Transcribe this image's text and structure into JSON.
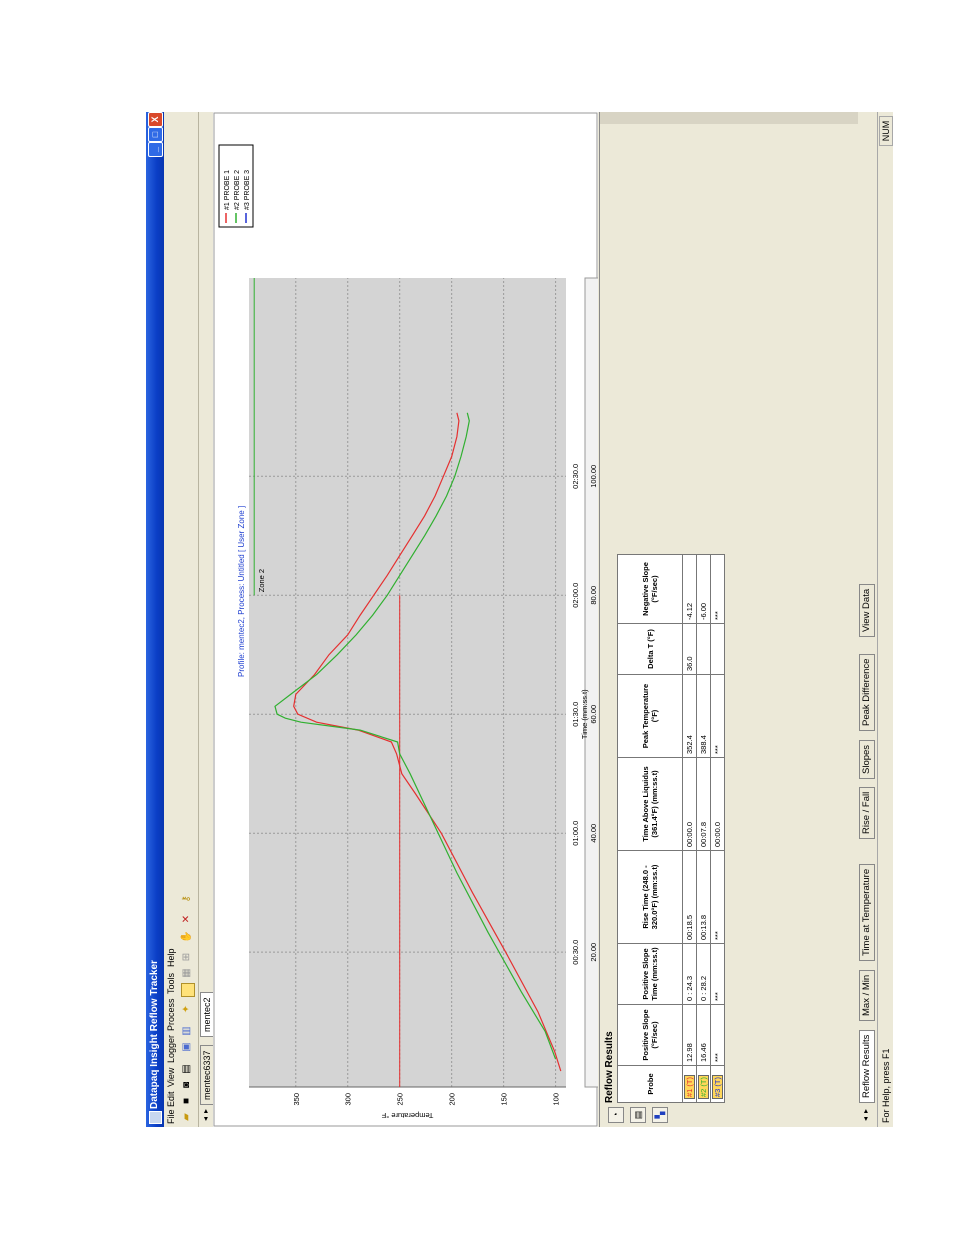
{
  "window": {
    "title": "Datapaq Insight Reflow Tracker",
    "controls": [
      "_",
      "□",
      "X"
    ]
  },
  "menu": [
    "File",
    "Edit",
    "View",
    "Logger",
    "Process",
    "Tools",
    "Help"
  ],
  "file_tabs": [
    "mentec6337",
    "mentec2"
  ],
  "chart_title": "Profile: mentec2, Process: Untitled [ User Zone ]",
  "chart_data": {
    "type": "line",
    "ylabel": "Temperature °F",
    "xlabel": "Time (mm:ss.t)",
    "x2label": "Distance (in)",
    "ylim": [
      90,
      395
    ],
    "y_ticks": [
      "100",
      "150",
      "200",
      "250",
      "300",
      "350"
    ],
    "x_ticks": [
      "00:30.0",
      "01:00.0",
      "01:30.0",
      "02:00.0",
      "02:30.0"
    ],
    "x2_ticks": [
      "20.00",
      "40.00",
      "60.00",
      "80.00",
      "100.00"
    ],
    "zone_label": "Zone 2",
    "zone_value": 390,
    "limit_line": 250,
    "colors": {
      "probe1": "#e53030",
      "probe2": "#30b030",
      "probe3": "#2030d0"
    },
    "series": [
      {
        "name": "#1 PROBE 1",
        "points": [
          [
            0,
            95
          ],
          [
            5,
            101
          ],
          [
            15,
            117
          ],
          [
            30,
            148
          ],
          [
            45,
            180
          ],
          [
            60,
            210
          ],
          [
            70,
            235
          ],
          [
            75,
            248
          ],
          [
            80,
            253
          ],
          [
            83,
            258
          ],
          [
            86,
            290
          ],
          [
            88,
            330
          ],
          [
            90,
            348
          ],
          [
            92,
            352
          ],
          [
            95,
            350
          ],
          [
            100,
            332
          ],
          [
            105,
            318
          ],
          [
            110,
            300
          ],
          [
            115,
            288
          ],
          [
            120,
            275
          ],
          [
            125,
            262
          ],
          [
            130,
            250
          ],
          [
            135,
            238
          ],
          [
            140,
            226
          ],
          [
            145,
            216
          ],
          [
            150,
            208
          ],
          [
            155,
            200
          ],
          [
            160,
            195
          ],
          [
            164,
            193
          ],
          [
            166,
            195
          ]
        ]
      },
      {
        "name": "#2 PROBE 2",
        "points": [
          [
            3,
            100
          ],
          [
            10,
            110
          ],
          [
            20,
            133
          ],
          [
            35,
            165
          ],
          [
            50,
            195
          ],
          [
            65,
            222
          ],
          [
            75,
            240
          ],
          [
            80,
            250
          ],
          [
            83,
            252
          ],
          [
            86,
            288
          ],
          [
            88,
            345
          ],
          [
            89,
            360
          ],
          [
            90,
            368
          ],
          [
            92,
            370
          ],
          [
            95,
            355
          ],
          [
            100,
            330
          ],
          [
            105,
            310
          ],
          [
            110,
            292
          ],
          [
            115,
            276
          ],
          [
            120,
            262
          ],
          [
            125,
            250
          ],
          [
            130,
            238
          ],
          [
            135,
            226
          ],
          [
            140,
            215
          ],
          [
            145,
            205
          ],
          [
            150,
            197
          ],
          [
            155,
            191
          ],
          [
            160,
            186
          ],
          [
            164,
            183
          ],
          [
            166,
            185
          ]
        ]
      }
    ]
  },
  "legend": [
    "#1 PROBE 1",
    "#2 PROBE 2",
    "#3 PROBE 3"
  ],
  "reflow": {
    "title": "Reflow Results",
    "headers": [
      "Probe",
      "Positive Slope (°F/sec)",
      "Positive Slope Time (mm:ss.t)",
      "Rise Time (248.0 - 320.0°F) (mm:ss.t)",
      "Time Above Liquidus (361.4°F) (mm:ss.t)",
      "Peak Temperature (°F)",
      "Delta T (°F)",
      "Negative Slope (°F/sec)"
    ],
    "rows": [
      [
        "#1 (T)",
        "12.98",
        "0 : 24.3",
        "00:18.5",
        "00:00.0",
        "352.4",
        "36.0",
        "-4.12"
      ],
      [
        "#2 (T)",
        "16.46",
        "0 : 28.2",
        "00:13.8",
        "00:07.8",
        "388.4",
        "",
        "-6.00"
      ],
      [
        "#3 (T)",
        "***",
        "***",
        "***",
        "00:00.0",
        "***",
        "",
        "***"
      ]
    ]
  },
  "bottom_tabs": [
    "Reflow Results",
    "Max / Min",
    "Time at Temperature",
    "Rise / Fall",
    "Slopes",
    "Peak Difference",
    "View Data"
  ],
  "status": {
    "help": "For Help, press F1",
    "num": "NUM"
  }
}
